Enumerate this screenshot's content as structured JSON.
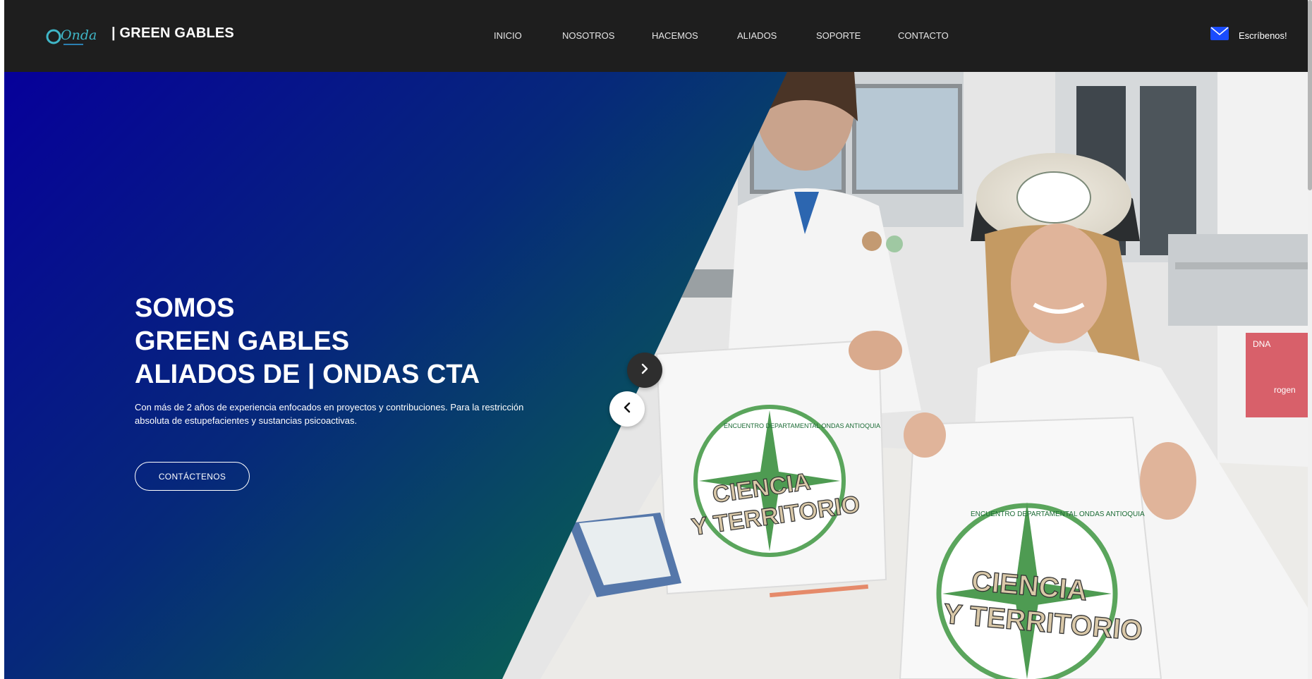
{
  "brand": {
    "logo_icon": "ondas-logo",
    "logo_text": "Ondas",
    "title": "| GREEN GABLES"
  },
  "nav": {
    "items": [
      {
        "label": "INICIO"
      },
      {
        "label": "NOSOTROS"
      },
      {
        "label": "HACEMOS"
      },
      {
        "label": "ALIADOS"
      },
      {
        "label": "SOPORTE"
      },
      {
        "label": "CONTACTO"
      }
    ]
  },
  "contact": {
    "icon": "envelope-icon",
    "label": "Escríbenos!"
  },
  "hero": {
    "title_line1": "SOMOS",
    "title_line2": "GREEN GABLES",
    "title_line3": "ALIADOS DE | ONDAS CTA",
    "description": "Con más de 2 años de experiencia enfocados en proyectos y contribuciones. Para la restricción absoluta de estupefacientes y sustancias psicoactivas.",
    "cta_label": "CONTÁCTENOS",
    "photo": {
      "bag_text_1": "CIENCIA",
      "bag_text_2": "Y TERRITORIO",
      "bag_arc_text": "ENCUENTRO DEPARTAMENTAL ONDAS ANTIOQUIA",
      "box_label": "DNA",
      "box_brand": "rogen"
    }
  },
  "carousel": {
    "next_icon": "chevron-right-icon",
    "prev_icon": "chevron-left-icon"
  },
  "colors": {
    "header_bg": "#1e1e1e",
    "gradient_start": "#06009a",
    "gradient_end": "#0a8a3c",
    "accent_blue": "#1a4cff"
  }
}
